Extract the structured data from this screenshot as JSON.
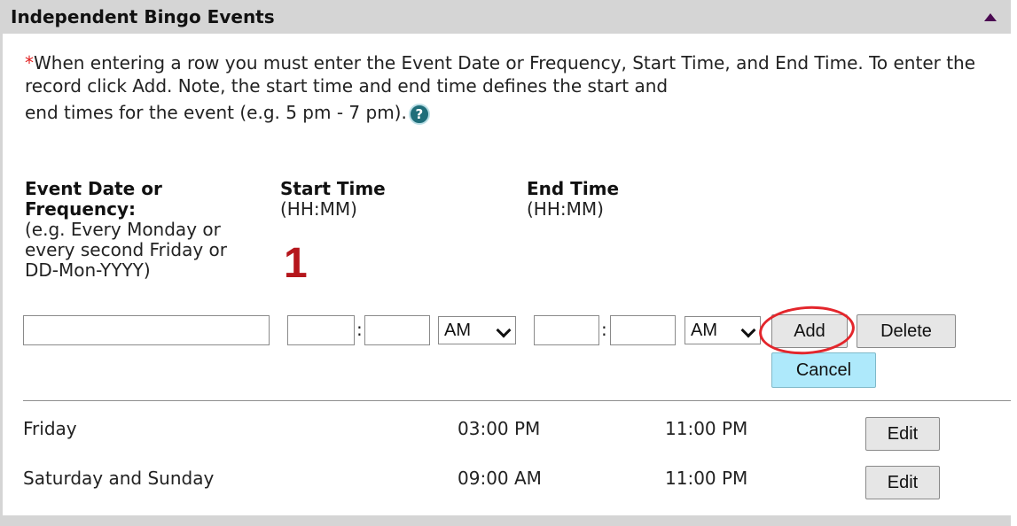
{
  "panel": {
    "title": "Independent Bingo Events"
  },
  "instructions": {
    "asterisk": "*",
    "text": "When entering a row you must enter the Event Date or Frequency, Start Time, and End Time. To enter the record click Add. Note, the start time and end time defines the start and",
    "line3": "end times for the event (e.g. 5 pm - 7 pm).",
    "help_glyph": "?"
  },
  "headers": {
    "event": {
      "title_line1": "Event Date or",
      "title_line2": "Frequency:",
      "hint_line1": "(e.g. Every Monday or",
      "hint_line2": "every second Friday or",
      "hint_line3": "DD-Mon-YYYY)"
    },
    "start": {
      "title": "Start Time",
      "format": "(HH:MM)"
    },
    "end": {
      "title": "End Time",
      "format": "(HH:MM)"
    }
  },
  "annotation_number": "1",
  "form": {
    "event_value": "",
    "start_hour": "",
    "start_minute": "",
    "start_ampm": "AM",
    "end_hour": "",
    "end_minute": "",
    "end_ampm": "AM",
    "colon": ":",
    "add_label": "Add",
    "delete_label": "Delete",
    "cancel_label": "Cancel"
  },
  "rows": [
    {
      "event": "Friday",
      "start": "03:00 PM",
      "end": "11:00 PM",
      "edit_label": "Edit"
    },
    {
      "event": "Saturday and Sunday",
      "start": "09:00 AM",
      "end": "11:00 PM",
      "edit_label": "Edit"
    }
  ],
  "colors": {
    "header_bg": "#d5d5d5",
    "required": "#e02020",
    "annotation": "#b5161c",
    "cancel_bg": "#aee9fb"
  },
  "icons": {
    "collapse": "triangle-up-icon",
    "help": "help-circle-icon",
    "dropdown": "chevron-down-icon"
  }
}
